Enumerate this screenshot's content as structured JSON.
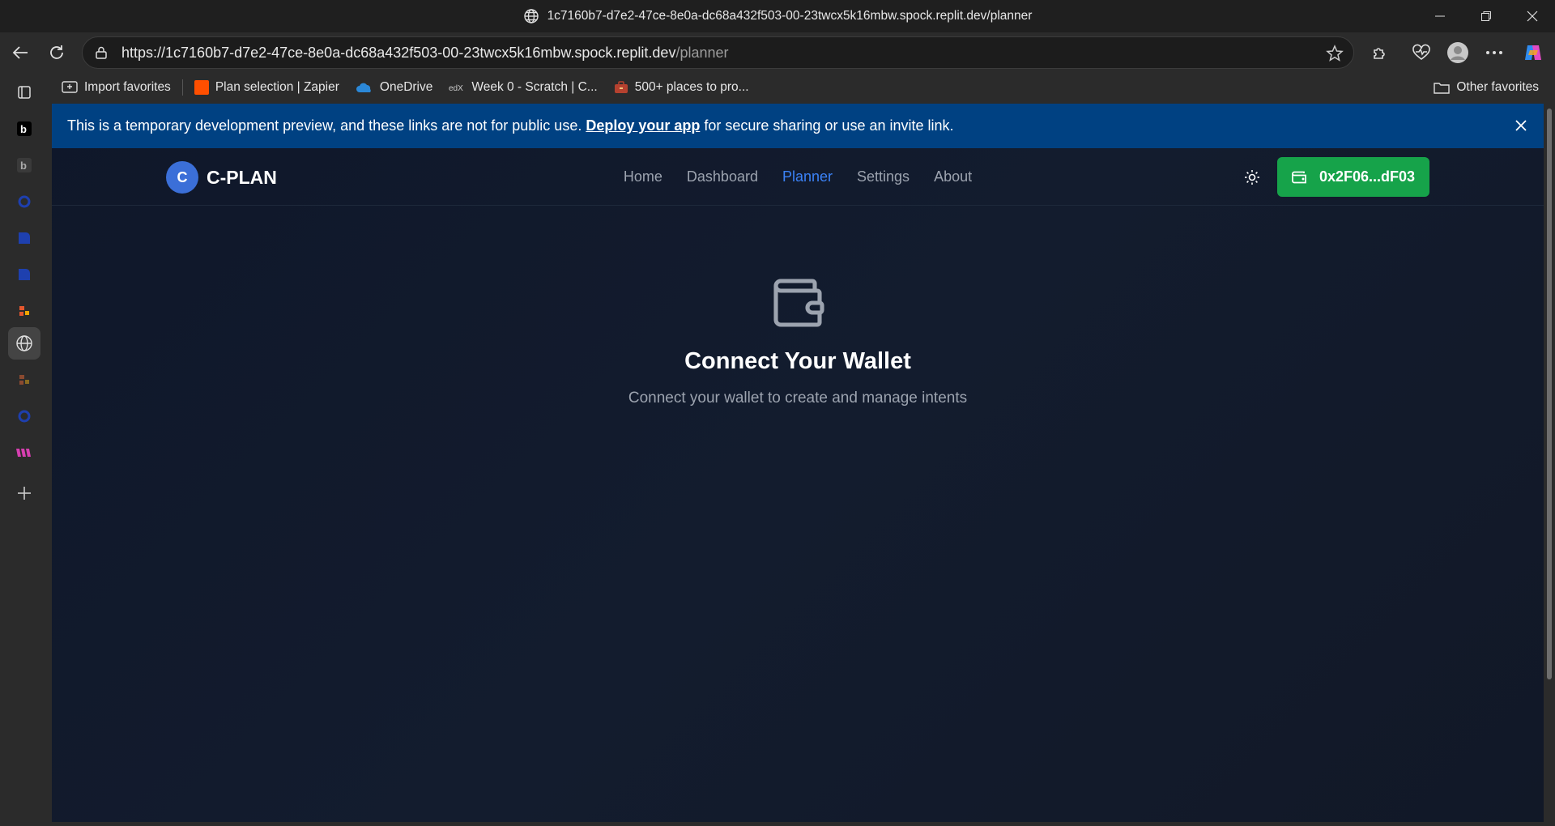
{
  "browser": {
    "window_title": "1c7160b7-d7e2-47ce-8e0a-dc68a432f503-00-23twcx5k16mbw.spock.replit.dev/planner",
    "url_host": "https://1c7160b7-d7e2-47ce-8e0a-dc68a432f503-00-23twcx5k16mbw.spock.replit.dev",
    "url_path": "/planner",
    "favorites": [
      {
        "label": "Import favorites",
        "icon": "import-icon"
      },
      {
        "label": "Plan selection | Zapier",
        "icon": "zapier-icon"
      },
      {
        "label": "OneDrive",
        "icon": "onedrive-icon"
      },
      {
        "label": "Week 0 - Scratch | C...",
        "icon": "edx-icon"
      },
      {
        "label": "500+ places to pro...",
        "icon": "briefcase-icon"
      }
    ],
    "other_favorites": "Other favorites"
  },
  "banner": {
    "text_before": "This is a temporary development preview, and these links are not for public use.",
    "link": "Deploy your app",
    "text_after": "for secure sharing or use an invite link."
  },
  "app": {
    "logo_letter": "C",
    "name": "C-PLAN",
    "nav": [
      {
        "label": "Home",
        "active": false
      },
      {
        "label": "Dashboard",
        "active": false
      },
      {
        "label": "Planner",
        "active": true
      },
      {
        "label": "Settings",
        "active": false
      },
      {
        "label": "About",
        "active": false
      }
    ],
    "wallet_address": "0x2F06...dF03"
  },
  "empty_state": {
    "icon": "wallet-icon",
    "title": "Connect Your Wallet",
    "subtitle": "Connect your wallet to create and manage intents"
  },
  "colors": {
    "accent": "#3b82f6",
    "wallet_button": "#16a34a",
    "banner": "#004182",
    "background": "#0f172a"
  }
}
